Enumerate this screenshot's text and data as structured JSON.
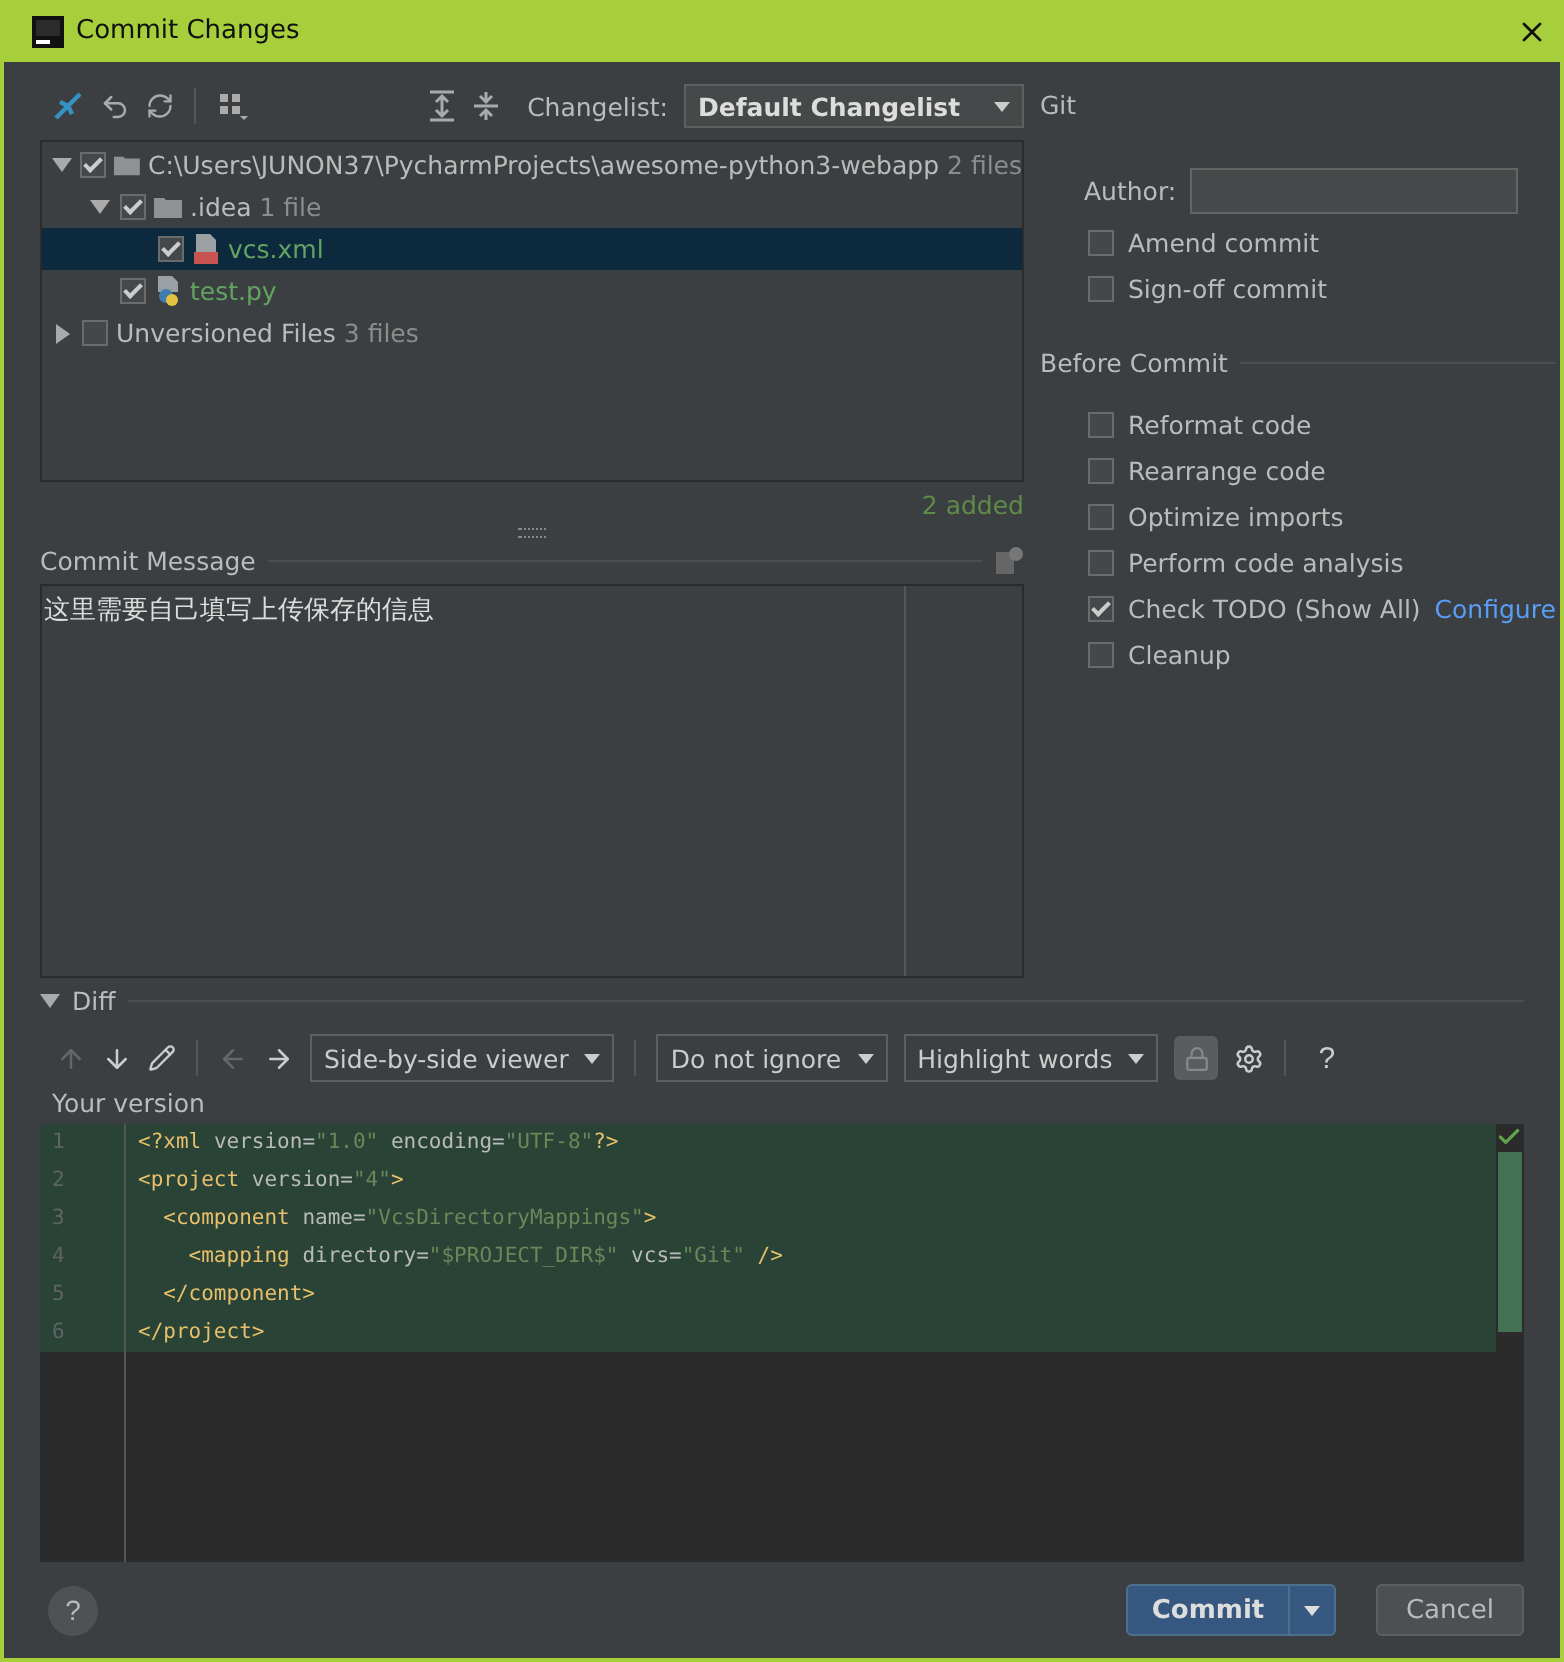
{
  "window": {
    "title": "Commit Changes"
  },
  "changelist": {
    "label": "Changelist:",
    "value": "Default Changelist"
  },
  "tree": [
    {
      "label": "C:\\Users\\JUNON37\\PycharmProjects\\awesome-python3-webapp",
      "hint": "2 files",
      "kind": "folder",
      "checked": true,
      "expanded": true,
      "selected": false,
      "children": [
        {
          "label": ".idea",
          "hint": "1 file",
          "kind": "folder",
          "checked": true,
          "expanded": true,
          "selected": false,
          "children": [
            {
              "label": "vcs.xml",
              "kind": "xml",
              "checked": true,
              "selected": true
            }
          ]
        },
        {
          "label": "test.py",
          "kind": "python",
          "checked": true,
          "selected": false
        }
      ]
    },
    {
      "label": "Unversioned Files",
      "hint": "3 files",
      "kind": "group",
      "checked": false,
      "expanded": false,
      "selected": false
    }
  ],
  "tree_status": "2 added",
  "commit_message": {
    "label": "Commit Message",
    "value": "这里需要自己填写上传保存的信息"
  },
  "git": {
    "title": "Git",
    "author_label": "Author:",
    "options": [
      {
        "label": "Amend commit",
        "checked": false
      },
      {
        "label": "Sign-off commit",
        "checked": false
      }
    ]
  },
  "before_commit": {
    "title": "Before Commit",
    "options": [
      {
        "label": "Reformat code",
        "checked": false
      },
      {
        "label": "Rearrange code",
        "checked": false
      },
      {
        "label": "Optimize imports",
        "checked": false
      },
      {
        "label": "Perform code analysis",
        "checked": false
      },
      {
        "label": "Check TODO (Show All)",
        "checked": true,
        "link": "Configure"
      },
      {
        "label": "Cleanup",
        "checked": false
      }
    ]
  },
  "diff": {
    "title": "Diff",
    "viewer": "Side-by-side viewer",
    "ignore": "Do not ignore",
    "highlight": "Highlight words",
    "help": "?",
    "pane_title": "Your version",
    "lines": [
      {
        "number": "1",
        "tokens": [
          {
            "text": "<?xml ",
            "kind": "tag"
          },
          {
            "text": "version=",
            "kind": "attr"
          },
          {
            "text": "\"1.0\"",
            "kind": "value"
          },
          {
            "text": " encoding=",
            "kind": "attr"
          },
          {
            "text": "\"UTF-8\"",
            "kind": "value"
          },
          {
            "text": "?>",
            "kind": "tag"
          }
        ]
      },
      {
        "number": "2",
        "tokens": [
          {
            "text": "<project ",
            "kind": "tag"
          },
          {
            "text": "version=",
            "kind": "attr"
          },
          {
            "text": "\"4\"",
            "kind": "value"
          },
          {
            "text": ">",
            "kind": "tag"
          }
        ]
      },
      {
        "number": "3",
        "tokens": [
          {
            "text": "  <component ",
            "kind": "tag"
          },
          {
            "text": "name=",
            "kind": "attr"
          },
          {
            "text": "\"VcsDirectoryMappings\"",
            "kind": "value"
          },
          {
            "text": ">",
            "kind": "tag"
          }
        ]
      },
      {
        "number": "4",
        "tokens": [
          {
            "text": "    <mapping ",
            "kind": "tag"
          },
          {
            "text": "directory=",
            "kind": "attr"
          },
          {
            "text": "\"$PROJECT_DIR$\"",
            "kind": "value"
          },
          {
            "text": " vcs=",
            "kind": "attr"
          },
          {
            "text": "\"Git\"",
            "kind": "value"
          },
          {
            "text": " />",
            "kind": "tag"
          }
        ]
      },
      {
        "number": "5",
        "tokens": [
          {
            "text": "  </component>",
            "kind": "tag"
          }
        ]
      },
      {
        "number": "6",
        "tokens": [
          {
            "text": "</project>",
            "kind": "tag"
          }
        ]
      }
    ]
  },
  "buttons": {
    "help": "?",
    "commit": "Commit",
    "cancel": "Cancel"
  }
}
